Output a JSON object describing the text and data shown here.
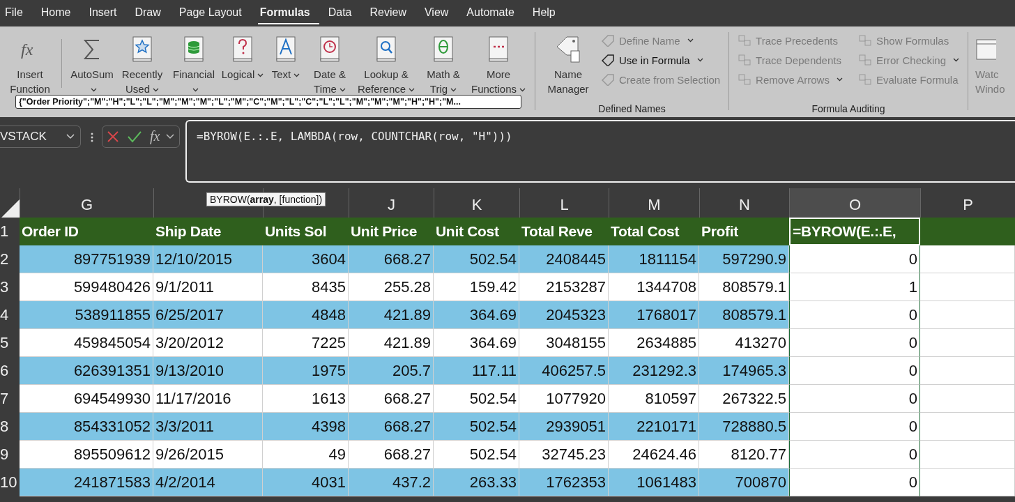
{
  "menu_tabs": [
    {
      "label": "File",
      "selected": false
    },
    {
      "label": "Home",
      "selected": false
    },
    {
      "label": "Insert",
      "selected": false
    },
    {
      "label": "Draw",
      "selected": false
    },
    {
      "label": "Page Layout",
      "selected": false
    },
    {
      "label": "Formulas",
      "selected": true
    },
    {
      "label": "Data",
      "selected": false
    },
    {
      "label": "Review",
      "selected": false
    },
    {
      "label": "View",
      "selected": false
    },
    {
      "label": "Automate",
      "selected": false
    },
    {
      "label": "Help",
      "selected": false
    }
  ],
  "ribbon": {
    "function_library": [
      {
        "label": "Insert Function",
        "glyph": "fx",
        "dropdown": false
      },
      {
        "label": "AutoSum",
        "dropdown": true
      },
      {
        "label": "Recently Used",
        "dropdown": true
      },
      {
        "label": "Financial",
        "dropdown": true
      },
      {
        "label": "Logical",
        "dropdown": true
      },
      {
        "label": "Text",
        "dropdown": true
      },
      {
        "label": "Date & Time",
        "dropdown": true
      },
      {
        "label": "Lookup & Reference",
        "dropdown": true
      },
      {
        "label": "Math & Trig",
        "dropdown": true
      },
      {
        "label": "More Functions",
        "dropdown": true
      }
    ],
    "defined_names": {
      "big_button": "Name Manager",
      "commands": [
        {
          "label": "Define Name",
          "disabled": true,
          "dropdown": true
        },
        {
          "label": "Use in Formula",
          "disabled": false,
          "dropdown": true
        },
        {
          "label": "Create from Selection",
          "disabled": true,
          "dropdown": false
        }
      ],
      "group_label": "Defined Names"
    },
    "formula_auditing": {
      "commands": [
        {
          "label": "Trace Precedents",
          "disabled": true,
          "dropdown": false
        },
        {
          "label": "Show Formulas",
          "disabled": true,
          "dropdown": false
        },
        {
          "label": "Trace Dependents",
          "disabled": true,
          "dropdown": false
        },
        {
          "label": "Error Checking",
          "disabled": true,
          "dropdown": true
        },
        {
          "label": "Remove Arrows",
          "disabled": true,
          "dropdown": true
        },
        {
          "label": "Evaluate Formula",
          "disabled": true,
          "dropdown": false
        }
      ],
      "group_label": "Formula Auditing"
    },
    "watch_window": "Watc Windo",
    "value_tooltip": "{\"Order Priority\";\"M\";\"H\";\"L\";\"L\";\"M\";\"M\";\"M\";\"L\";\"M\";\"C\";\"M\";\"L\";\"C\";\"L\";\"L\";\"M\";\"M\";\"M\";\"H\";\"H\";\"M..."
  },
  "formula_bar": {
    "name_box": "VSTACK",
    "fx_glyph": "fx",
    "formula": "=BYROW(E.:.E, LAMBDA(row, COUNTCHAR(row, \"H\")))",
    "tooltip": "BYROW(**array**, [function])"
  },
  "sheet": {
    "columns": [
      {
        "letter": "G",
        "selected": false
      },
      {
        "selected": false
      },
      {
        "selected": false
      },
      {
        "letter": "J",
        "selected": false
      },
      {
        "letter": "K",
        "selected": false
      },
      {
        "letter": "L",
        "selected": false
      },
      {
        "letter": "M",
        "selected": false
      },
      {
        "letter": "N",
        "selected": false
      },
      {
        "letter": "O",
        "selected": true
      },
      {
        "letter": "P",
        "selected": false
      }
    ],
    "rows": [
      {
        "number": "1",
        "kind": "header",
        "cells": [
          "Order ID",
          "Ship Date",
          "Units Sol",
          "Unit Price",
          "Unit Cost",
          "Total Reve",
          "Total Cost",
          "Profit",
          "=BYROW(E.:.E,"
        ]
      },
      {
        "number": "2",
        "kind": "data",
        "cells": [
          "897751939",
          "12/10/2015",
          "3604",
          "668.27",
          "502.54",
          "2408445",
          "1811154",
          "597290.9",
          "0"
        ]
      },
      {
        "number": "3",
        "kind": "data",
        "cells": [
          "599480426",
          "9/1/2011",
          "8435",
          "255.28",
          "159.42",
          "2153287",
          "1344708",
          "808579.1",
          "1"
        ]
      },
      {
        "number": "4",
        "kind": "data",
        "cells": [
          "538911855",
          "6/25/2017",
          "4848",
          "421.89",
          "364.69",
          "2045323",
          "1768017",
          "808579.1",
          "0"
        ]
      },
      {
        "number": "5",
        "kind": "data",
        "cells": [
          "459845054",
          "3/20/2012",
          "7225",
          "421.89",
          "364.69",
          "3048155",
          "2634885",
          "413270",
          "0"
        ]
      },
      {
        "number": "6",
        "kind": "data",
        "cells": [
          "626391351",
          "9/13/2010",
          "1975",
          "205.7",
          "117.11",
          "406257.5",
          "231292.3",
          "174965.3",
          "0"
        ]
      },
      {
        "number": "7",
        "kind": "data",
        "cells": [
          "694549930",
          "11/17/2016",
          "1613",
          "668.27",
          "502.54",
          "1077920",
          "810597",
          "267322.5",
          "0"
        ]
      },
      {
        "number": "8",
        "kind": "data",
        "cells": [
          "854331052",
          "3/3/2011",
          "4398",
          "668.27",
          "502.54",
          "2939051",
          "2210171",
          "728880.5",
          "0"
        ]
      },
      {
        "number": "9",
        "kind": "data",
        "cells": [
          "895509612",
          "9/26/2015",
          "49",
          "668.27",
          "502.54",
          "32745.23",
          "24624.46",
          "8120.77",
          "0"
        ]
      },
      {
        "number": "10",
        "kind": "data",
        "cells": [
          "241871583",
          "4/2/2014",
          "4031",
          "437.2",
          "263.33",
          "1762353",
          "1061483",
          "700870",
          "0"
        ]
      }
    ]
  }
}
